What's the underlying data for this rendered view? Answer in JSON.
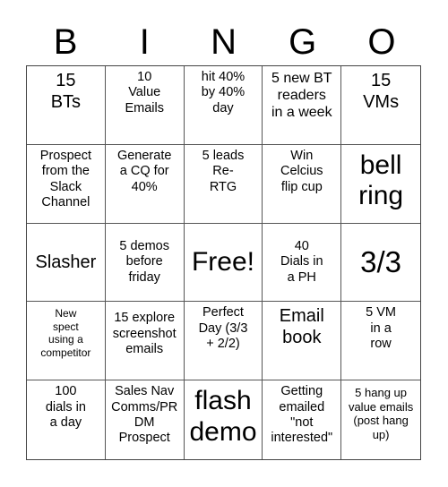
{
  "header": {
    "letters": [
      "B",
      "I",
      "N",
      "G",
      "O"
    ]
  },
  "cells": [
    [
      "15\nBTs",
      "10\nValue\nEmails",
      "hit 40%\nby 40%\nday",
      "5 new BT\nreaders\nin a week",
      "15\nVMs"
    ],
    [
      "Prospect\nfrom the\nSlack\nChannel",
      "Generate\na CQ for\n40%",
      "5 leads\nRe-\nRTG",
      "Win\nCelcius\nflip cup",
      "bell\nring"
    ],
    [
      "Slasher",
      "5 demos\nbefore\nfriday",
      "Free!",
      "40\nDials in\na PH",
      "3/3"
    ],
    [
      "New\nspect\nusing a\ncompetitor",
      "15 explore\nscreenshot\nemails",
      "Perfect\nDay (3/3\n+ 2/2)",
      "Email\nbook",
      "5 VM\nin a\nrow"
    ],
    [
      "100\ndials in\na day",
      "Sales Nav\nComms/PR\nDM\nProspect",
      "flash\ndemo",
      "Getting\nemailed\n\"not\ninterested\"",
      "5 hang up\nvalue emails\n(post hang\nup)"
    ]
  ]
}
